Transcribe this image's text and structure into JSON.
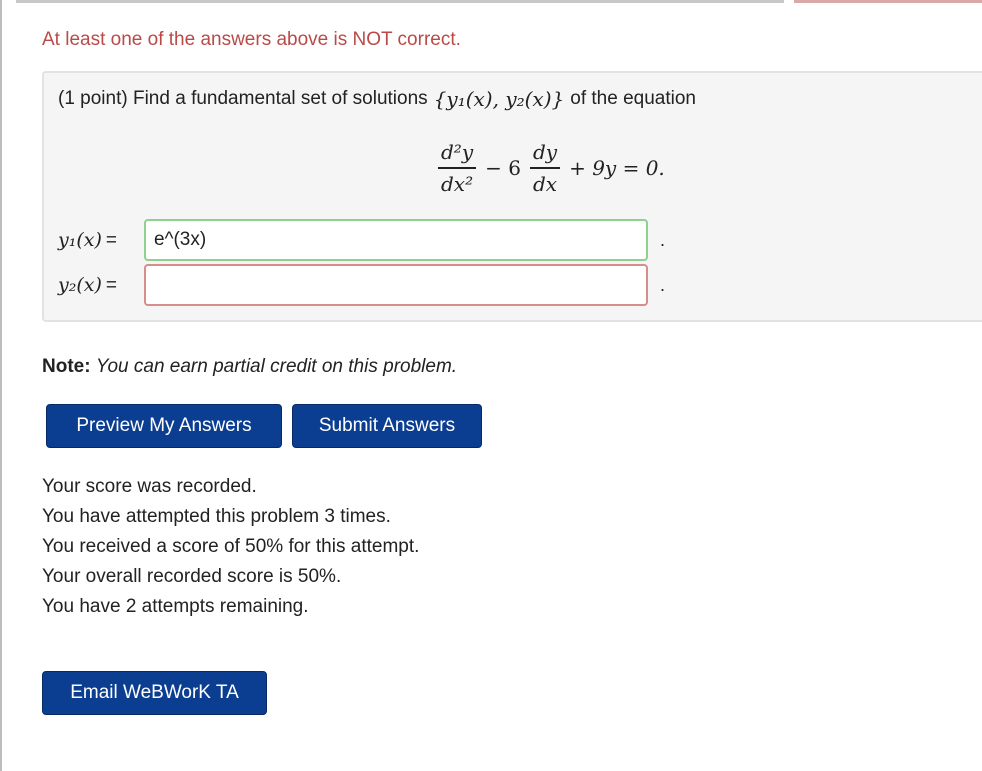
{
  "warning": "At least one of the answers above is NOT correct.",
  "problem": {
    "points": "(1 point)",
    "prompt_start": "Find a fundamental set of solutions",
    "solution_set": "{y₁(x), y₂(x)}",
    "prompt_end": "of the equation",
    "equation": {
      "frac1_num": "d²y",
      "frac1_den": "dx²",
      "minus": "− 6",
      "frac2_num": "dy",
      "frac2_den": "dx",
      "rest": "+ 9y = 0."
    },
    "answers": [
      {
        "label": "y₁(x)",
        "equals": "=",
        "value": "e^(3x)",
        "status": "correct",
        "trail": "."
      },
      {
        "label": "y₂(x)",
        "equals": "=",
        "value": "",
        "status": "incorrect",
        "trail": "."
      }
    ]
  },
  "note": {
    "label": "Note:",
    "text": "You can earn partial credit on this problem."
  },
  "buttons": {
    "preview": "Preview My Answers",
    "submit": "Submit Answers",
    "email": "Email WeBWorK TA"
  },
  "score": {
    "recorded": "Your score was recorded.",
    "attempted": "You have attempted this problem 3 times.",
    "received": "You received a score of 50% for this attempt.",
    "overall": "Your overall recorded score is 50%.",
    "remaining": "You have 2 attempts remaining."
  },
  "colors": {
    "warning": "#b94a48",
    "button": "#0b3d91",
    "correct_border": "#8fcf8f",
    "incorrect_border": "#d88d8d"
  }
}
